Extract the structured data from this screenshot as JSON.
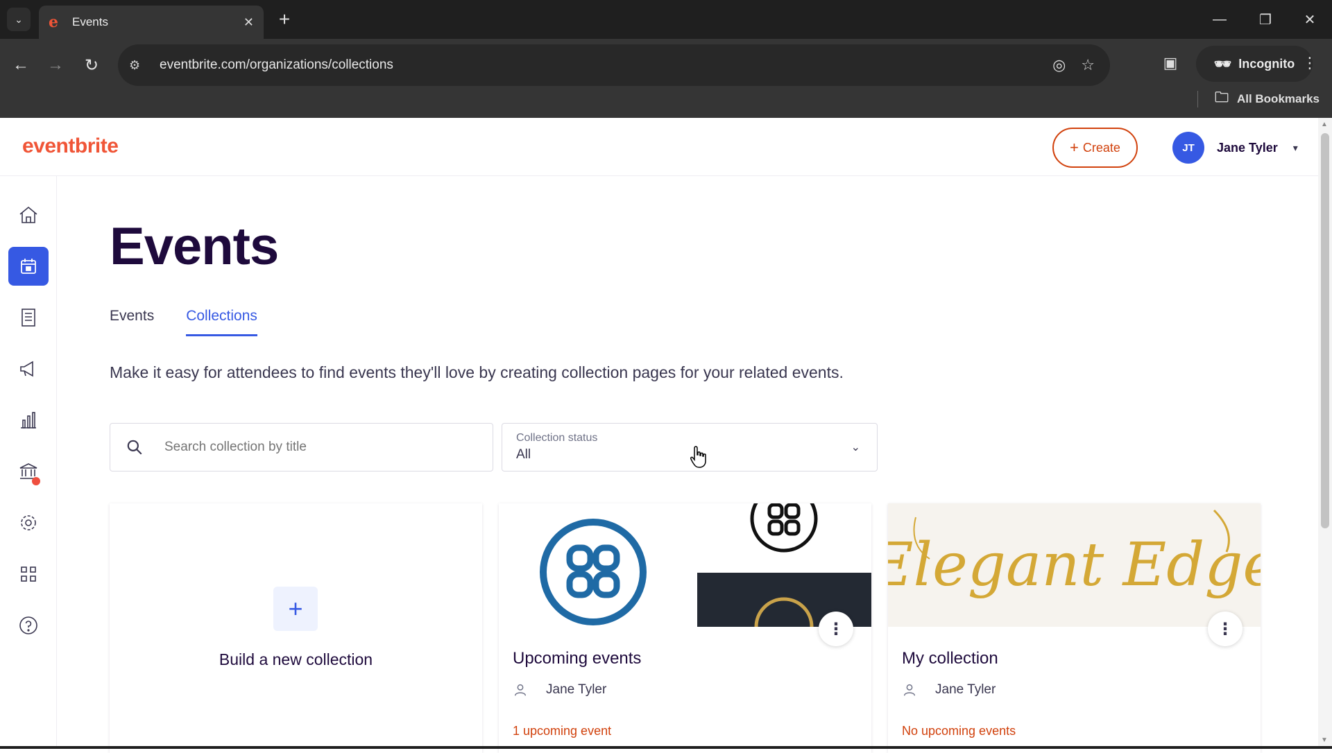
{
  "browser": {
    "tab_title": "Events",
    "url": "eventbrite.com/organizations/collections",
    "incognito_label": "Incognito",
    "bookmarks_label": "All Bookmarks"
  },
  "header": {
    "logo": "eventbrite",
    "create_label": "Create",
    "user_initials": "JT",
    "user_name": "Jane Tyler"
  },
  "sidebar": {
    "items": [
      "home",
      "events",
      "orders",
      "marketing",
      "reports",
      "finance",
      "settings",
      "apps",
      "help"
    ],
    "active": "events"
  },
  "main": {
    "title": "Events",
    "tabs": [
      {
        "label": "Events",
        "active": false
      },
      {
        "label": "Collections",
        "active": true
      }
    ],
    "description": "Make it easy for attendees to find events they'll love by creating collection pages for your related events.",
    "search_placeholder": "Search collection by title",
    "status_label": "Collection status",
    "status_value": "All"
  },
  "cards": {
    "new_label": "Build a new collection",
    "collections": [
      {
        "title": "Upcoming events",
        "owner": "Jane Tyler",
        "count_text": "1 upcoming event"
      },
      {
        "title": "My collection",
        "owner": "Jane Tyler",
        "count_text": "No upcoming events",
        "image_text": "Elegant Edge"
      }
    ]
  },
  "colors": {
    "brand": "#f05537",
    "accent": "#3659e3",
    "navy": "#1e0a3c",
    "orange_text": "#d1410c",
    "gold": "#d4a836"
  }
}
